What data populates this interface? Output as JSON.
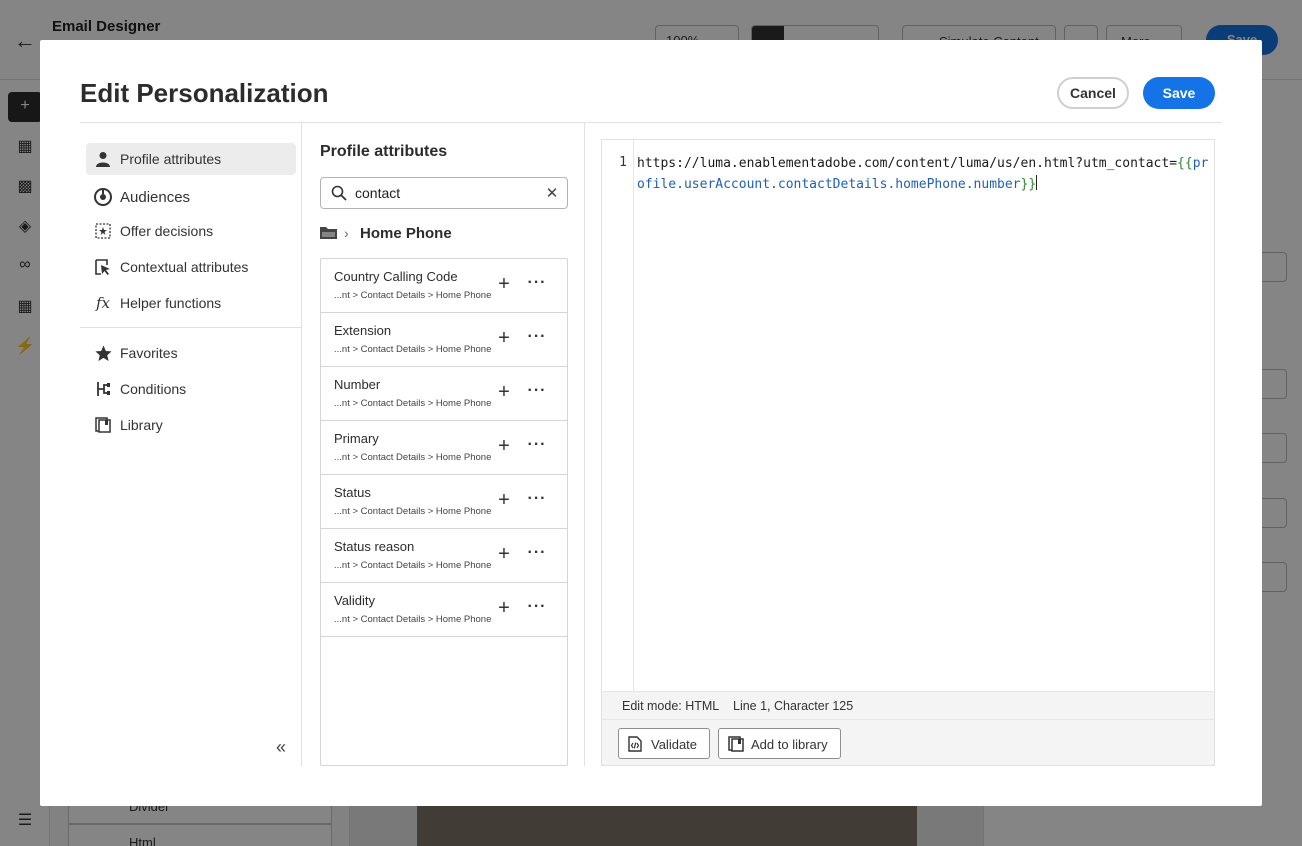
{
  "app": {
    "title": "Email Designer",
    "zoom": "100%",
    "simulate_label": "Simulate Content",
    "more_label": "More",
    "save_label": "Save",
    "left_rows": [
      "Divider",
      "Html"
    ]
  },
  "modal": {
    "title": "Edit Personalization",
    "cancel_label": "Cancel",
    "save_label": "Save"
  },
  "nav": {
    "group1": [
      {
        "label": "Profile attributes",
        "icon": "user-icon",
        "active": true
      },
      {
        "label": "Audiences",
        "icon": "audiences-icon"
      },
      {
        "label": "Offer decisions",
        "icon": "offer-icon"
      },
      {
        "label": "Contextual attributes",
        "icon": "contextual-icon"
      },
      {
        "label": "Helper functions",
        "icon": "function-icon"
      }
    ],
    "group2": [
      {
        "label": "Favorites",
        "icon": "star-icon"
      },
      {
        "label": "Conditions",
        "icon": "conditions-icon"
      },
      {
        "label": "Library",
        "icon": "library-icon"
      }
    ]
  },
  "browser": {
    "title": "Profile attributes",
    "search_value": "contact",
    "breadcrumb": "Home Phone",
    "items": [
      {
        "name": "Country Calling Code",
        "path": "...nt > Contact Details > Home Phone"
      },
      {
        "name": "Extension",
        "path": "...nt > Contact Details > Home Phone"
      },
      {
        "name": "Number",
        "path": "...nt > Contact Details > Home Phone"
      },
      {
        "name": "Primary",
        "path": "...nt > Contact Details > Home Phone"
      },
      {
        "name": "Status",
        "path": "...nt > Contact Details > Home Phone"
      },
      {
        "name": "Status reason",
        "path": "...nt > Contact Details > Home Phone"
      },
      {
        "name": "Validity",
        "path": "...nt > Contact Details > Home Phone"
      }
    ]
  },
  "editor": {
    "line_number": "1",
    "code_prefix": "https://luma.enablementadobe.com/content/luma/us/en.html?utm_contact=",
    "brace_open": "{{",
    "code_variable": "profile.userAccount.contactDetails.homePhone.number",
    "brace_close": "}}",
    "edit_mode": "Edit mode: HTML",
    "cursor_position": "Line 1, Character 125",
    "validate_label": "Validate",
    "add_library_label": "Add to library"
  },
  "colors": {
    "accent": "#1473e6",
    "code_brace": "#2c8a2c",
    "code_variable": "#1f5fb7"
  }
}
